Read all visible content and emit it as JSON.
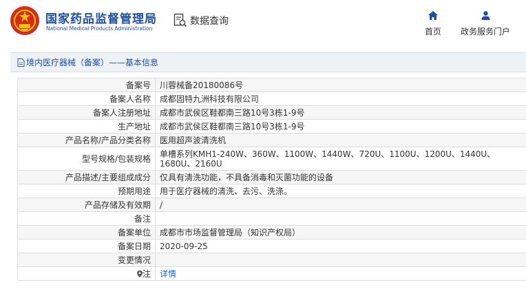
{
  "header": {
    "brand_cn": "国家药品监督管理局",
    "brand_en": "National Medical Products Administration",
    "query_label": "数据查询",
    "query_icon": "search-document-icon",
    "nav": {
      "home_label": "首页",
      "home_icon": "home-icon",
      "portal_label": "政务服务门户",
      "portal_icon": "user-icon"
    },
    "brand_color": "#1f4fa0"
  },
  "breadcrumb": {
    "text": "境内医疗器械（备案）——基本信息",
    "icon": "document-icon"
  },
  "record": {
    "rows": [
      {
        "label": "备案号",
        "value": "川蓉械备20180086号"
      },
      {
        "label": "备案人名称",
        "value": "成都固特九洲科技有限公司"
      },
      {
        "label": "备案人注册地址",
        "value": "成都市武侯区鞋都南三路10号3栋1-9号"
      },
      {
        "label": "生产地址",
        "value": "成都市武侯区鞋都南三路10号3栋1-9号"
      },
      {
        "label": "产品名称/产品分类名称",
        "value": "医用超声波清洗机"
      },
      {
        "label": "型号规格/包装规格",
        "value": "单槽系列KMH1-240W、360W、1100W、1440W、720U、1100U、1200U、1440U、1680U、2160U"
      },
      {
        "label": "产品描述/主要组成成分",
        "value": "仅具有清洗功能，不具备消毒和灭菌功能的设备"
      },
      {
        "label": "预期用途",
        "value": "用于医疗器械的清洗、去污、洗涤。"
      },
      {
        "label": "产品存储及有效期",
        "value": "/"
      },
      {
        "label": "备注",
        "value": ""
      },
      {
        "label": "备案单位",
        "value": "成都市市场监督管理局（知识产权局）"
      },
      {
        "label": "备案日期",
        "value": "2020-09-25"
      },
      {
        "label": "变更情况",
        "value": ""
      },
      {
        "label": "注",
        "value": "详情",
        "icon": "location-pin-icon"
      }
    ]
  }
}
